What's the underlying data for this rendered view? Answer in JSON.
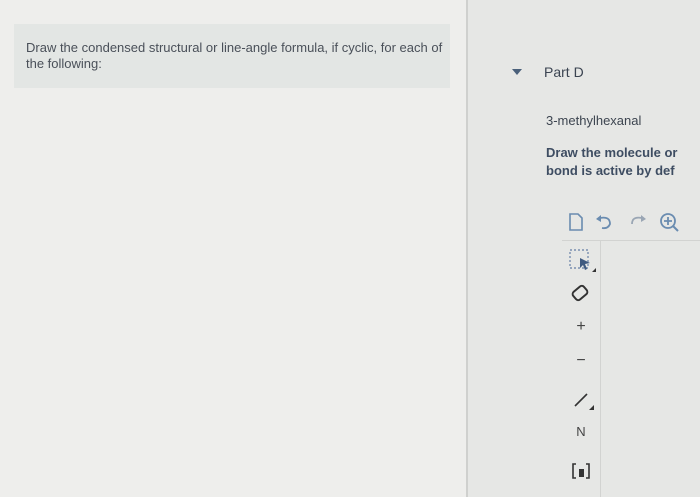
{
  "instruction": "Draw the condensed structural or line-angle formula, if cyclic, for each of the following:",
  "part": {
    "label": "Part D"
  },
  "compound_name": "3-methylhexanal",
  "prompt": {
    "line1": "Draw the molecule or",
    "line2": "bond is active by def"
  },
  "toolbar": {
    "top": [
      "new-document-icon",
      "undo-icon",
      "redo-icon",
      "zoom-in-icon"
    ],
    "left": [
      "select-icon",
      "eraser-icon",
      "plus-icon",
      "minus-icon",
      "single-bond-icon",
      "chain-icon",
      "bracket-icon"
    ],
    "plus_glyph": "+",
    "minus_glyph": "−",
    "chain_glyph": "N"
  }
}
